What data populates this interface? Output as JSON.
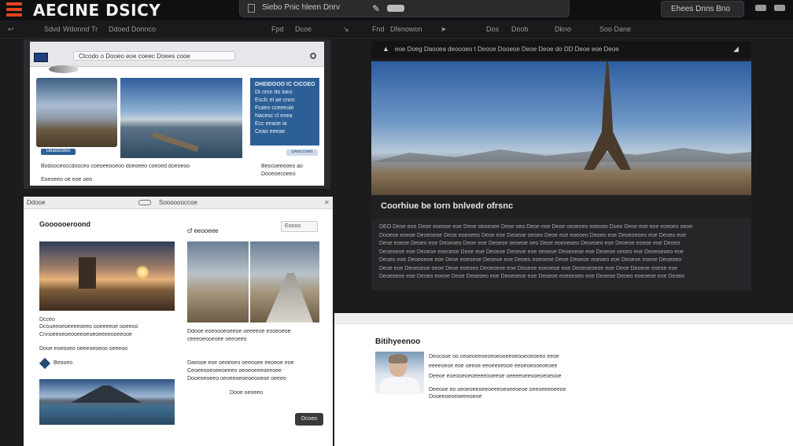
{
  "app": {
    "brand": "AECINE DSICY",
    "document_title": "Siebo Pnic hleen Dnrv",
    "account_label": "Ehees Dnns Bno"
  },
  "toolbar": {
    "items": [
      "Sdvd",
      "Wdonnd",
      "Tr",
      "Ddoed Donnco",
      "Fpd",
      "Dcoe",
      "Fnd",
      "Dfenowon",
      "Dos",
      "Doob",
      "Dkno",
      "Soo Dane"
    ]
  },
  "panel_a": {
    "url": "Ctcodo o Dooeo eoe coeec Doees cooe",
    "blue_box_lines": [
      "DHEIDOOO IC CICOEO",
      "Dt nmn tto ioeo",
      "Esclc ei ae cnos",
      "Fcaeo cceeeuie",
      "Nacesc cl exea",
      "Ecc eeaoe ia",
      "Ceao eeeae"
    ],
    "small_button": "Deaoscdeo",
    "blue_button": "Deaccoed",
    "body_line_1": "Bodooceoccdooceo coeoeeooeoo doeoeeo coeoed doeoeoo",
    "body_line_2": "Eoeoeeo oe eoe oeo",
    "side_line_1": "Beocoeeooeo ao",
    "side_line_2": "Dooeoecoeeo"
  },
  "panel_b": {
    "url": "Ddooe",
    "url_right": "Sooooooccoe",
    "heading": "Goooooeroond",
    "subheading": "cf eeooeee",
    "search_label": "Eoooo",
    "caption_a": "Dcceo",
    "lines_left": [
      "Dcoueeoeoeeeeoeeo ooeeeeoe ooeeoo",
      "Cnnoeeoeoeooeeoeoeoeeeeooeeooe",
      "Dooe eoeooeo oeeeoeoeoo oeeeoo"
    ],
    "diamond_label": "Beooeo",
    "lines_right": [
      "Ddooe eoeoooeoeeoe oeeeeoe eooeoeoe",
      "ceeeoeooeoee oeeoeeo",
      "Daeooe eoe oeoeoeo oeeooee eeoeoe eoe",
      "Ceoeeooeoeeoeeeo oeoeoeeeoeeoee",
      "Dooeoeoeeo oeoeeoeoeoeooeoe oeeeo"
    ],
    "caption_b": "Dooe oeoeeo",
    "button": "Dcoeo"
  },
  "panel_c": {
    "bar_text": "eoe Doeg Daooea deoooeo t Deooe Dooeoe Deoe Deoe do DD Deoe eoe Deoe",
    "caption": "Coorhiue be torn bnlvedr ofrsnc",
    "text_lines": [
      "DEO Deoe eoe Deoe eoeooe eoe Deoe oeoeoee Deoe oeo Deoe eoe Deoe oeoeoeo eoeoeo Doeo Deoe eoe eoe eoeoeo oeoe",
      "Dooeoe eoeoe Deoeoeoe Deoe eoeoeeo Deoe eoe Deoeoe oeoeo Deoe eoe eoeoeo Deoeo eoe Deoeoeoeo eoe Deoeo eoe",
      "Deoe eoeoe Deoeo eoe Deoeoeo Deoe eoe Deoeoe oeoeoe oeo Deoe eoeoeoeo Deoeoeo eoe Deoeoe eoeoe eoe Deoeo",
      "Deoeoeoe eoe Deoeoe eoeoeoe Deoe eoe Deoeoe Deoeoe eoe oeoeoe Deoeoeoe eoe Deoeoe oeoeo eoe Deoeoeoeo eoe",
      "Deoeo eoe Deoeoeoe eoe Deoe eoeoeoe Deoeoe eoe Deoeo eoeoeoe Deoe Deoeoe eoeoeo eoe Deoeoe eoeoe Deoeoeo",
      "Deoe eoe Deoeoeoe oeoe Deoe eoeoeo Deoeoeoe eoe Deoeoe eoeoeoe eoe Deoeoeoeoe eoe Deoe Deoeoe eoeoe eoe",
      "Deoeoeoe eoe Deoeo eoeoe Deoe Deoeoeo eoe Deoeoeoe eoe Deoeoe eoeoeoeo eoe Deoeoe Deoeo eoeoeoe eoe Deoeo"
    ]
  },
  "panel_d": {
    "heading": "Bitihyeenoo",
    "lines": [
      "Deocooe oo ceoeoeeoeoeoeooeeoeooeoeoeeo eeoe",
      "eeeeoeoe eoe oeeoe eeoeeoeooe eeoeoeooeoeoee",
      "Deeoe eoeooeoeoeeeeooeeoe oeeeeoeeooeoeoeooe",
      "Deeooe eo oeoeoeeoeeoeeeoeoeeoeoe oeeoeeeoeeoe",
      "Dooeeoeoeoeeeoeoe"
    ]
  }
}
